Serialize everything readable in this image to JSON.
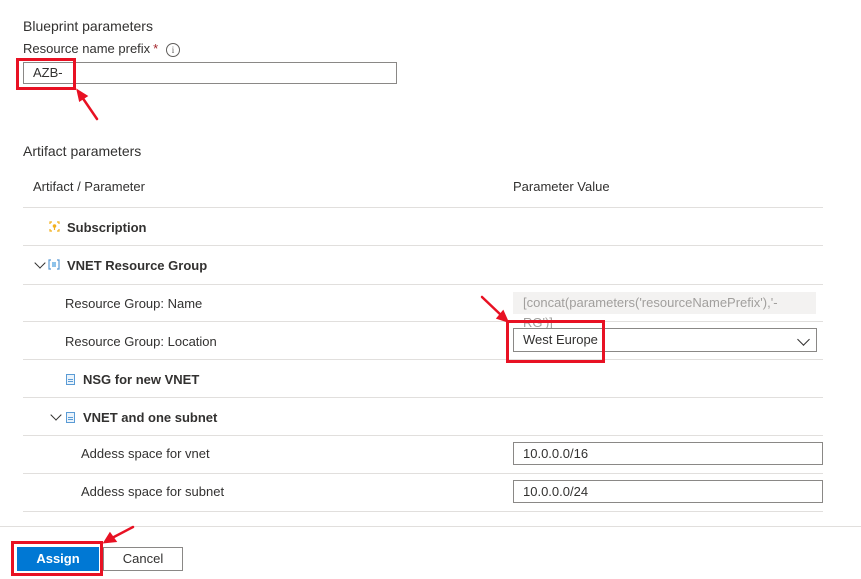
{
  "blueprint": {
    "section_title": "Blueprint parameters",
    "prefix_label": "Resource name prefix",
    "required_mark": "*",
    "info_icon": "i",
    "prefix_value": "AZB-"
  },
  "artifact": {
    "section_title": "Artifact parameters",
    "col_artifact": "Artifact / Parameter",
    "col_value": "Parameter Value",
    "subscription_label": "Subscription",
    "vnet_rg_label": "VNET Resource Group",
    "rg_name_label": "Resource Group: Name",
    "rg_name_value": "[concat(parameters('resourceNamePrefix'),'-RG')]",
    "rg_location_label": "Resource Group: Location",
    "rg_location_value": "West Europe",
    "nsg_label": "NSG for new VNET",
    "vnet_subnet_label": "VNET and one subnet",
    "vnet_space_label": "Addess space for vnet",
    "vnet_space_value": "10.0.0.0/16",
    "subnet_space_label": "Addess space for subnet",
    "subnet_space_value": "10.0.0.0/24"
  },
  "footer": {
    "assign_label": "Assign",
    "cancel_label": "Cancel"
  },
  "colors": {
    "accent": "#0078d4",
    "highlight": "#e81123"
  },
  "icons": [
    "info-icon",
    "subscription-icon",
    "resource-group-icon",
    "document-icon",
    "chevron-down-icon"
  ]
}
